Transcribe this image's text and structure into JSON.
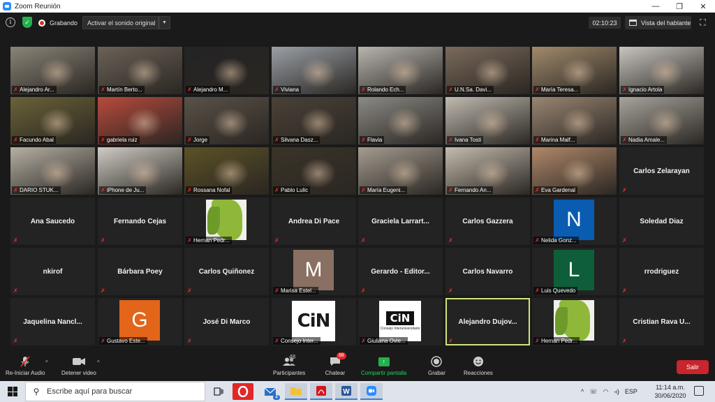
{
  "window": {
    "title": "Zoom Reunión",
    "controls": {
      "minimize": "—",
      "maximize": "❐",
      "close": "✕"
    }
  },
  "topbar": {
    "recording_label": "Grabando",
    "original_sound_label": "Activar el sonido original",
    "timer": "02:10:23",
    "view_label": "Vista del hablante"
  },
  "participants": [
    {
      "name": "Alejandro Ar...",
      "type": "video",
      "color": "#8a8478"
    },
    {
      "name": "Martín Berto...",
      "type": "video",
      "color": "#6b6258"
    },
    {
      "name": "Alejandro M...",
      "type": "video",
      "color": "#242424"
    },
    {
      "name": "Viviana",
      "type": "video",
      "color": "#9aa0a6"
    },
    {
      "name": "Rolando Ech...",
      "type": "video",
      "color": "#b8b4ae"
    },
    {
      "name": "U.N.Sa. Davi...",
      "type": "video",
      "color": "#7a6a5c"
    },
    {
      "name": "María Teresa...",
      "type": "video",
      "color": "#a08a6c"
    },
    {
      "name": "Ignacio Artola",
      "type": "video",
      "color": "#c8c4be"
    },
    {
      "name": "Facundo Abal",
      "type": "video",
      "color": "#6a6238"
    },
    {
      "name": "gabriela ruiz",
      "type": "video",
      "color": "#b84a3c"
    },
    {
      "name": "Jorge",
      "type": "video",
      "color": "#5a5248"
    },
    {
      "name": "Silvana Dasz...",
      "type": "video",
      "color": "#4a4238"
    },
    {
      "name": "Flavia",
      "type": "video",
      "color": "#8c8a84"
    },
    {
      "name": "Ivana Tosti",
      "type": "video",
      "color": "#c0bab0"
    },
    {
      "name": "Marina Malf...",
      "type": "video",
      "color": "#9a8672"
    },
    {
      "name": "Nadia Amale...",
      "type": "video",
      "color": "#a8a49c"
    },
    {
      "name": "DARIO STUK...",
      "type": "video",
      "color": "#b6b0a4"
    },
    {
      "name": "iPhone de Ju...",
      "type": "video",
      "color": "#d0ccc4"
    },
    {
      "name": "Rossana Nofal",
      "type": "video",
      "color": "#5c5226"
    },
    {
      "name": "Pablo Lulic",
      "type": "video",
      "color": "#3a3428"
    },
    {
      "name": "María Eugeni...",
      "type": "video",
      "color": "#a49c90"
    },
    {
      "name": "Fernando An...",
      "type": "video",
      "color": "#c4bcae"
    },
    {
      "name": "Eva Gardenal",
      "type": "video",
      "color": "#b0886a"
    },
    {
      "name": "Carlos Zelarayan",
      "type": "name"
    },
    {
      "name": "Ana Saucedo",
      "type": "name"
    },
    {
      "name": "Fernando Cejas",
      "type": "name"
    },
    {
      "name": "Hernan Pedr...",
      "type": "map"
    },
    {
      "name": "Andrea Di Pace",
      "type": "name"
    },
    {
      "name": "Graciela  Larrart...",
      "type": "name"
    },
    {
      "name": "Carlos Gazzera",
      "type": "name"
    },
    {
      "name": "Nelida Gonz...",
      "type": "avatar",
      "letter": "N",
      "color": "#0a5cb0"
    },
    {
      "name": "Soledad Diaz",
      "type": "name"
    },
    {
      "name": "nkirof",
      "type": "name"
    },
    {
      "name": "Bárbara Poey",
      "type": "name"
    },
    {
      "name": "Carlos Quiñonez",
      "type": "name"
    },
    {
      "name": "Marisa Estel...",
      "type": "avatar",
      "letter": "M",
      "color": "#8a7062"
    },
    {
      "name": "Gerardo  -  Editor...",
      "type": "name"
    },
    {
      "name": "Carlos Navarro",
      "type": "name"
    },
    {
      "name": "Luis Quevedo",
      "type": "avatar",
      "letter": "L",
      "color": "#0f5e3a"
    },
    {
      "name": "rrodriguez",
      "type": "name"
    },
    {
      "name": "Jaquelina  Nancl...",
      "type": "name"
    },
    {
      "name": "Gustavo Este...",
      "type": "avatar",
      "letter": "G",
      "color": "#e2651a"
    },
    {
      "name": "José Di Marco",
      "type": "name"
    },
    {
      "name": "Consejo Inter...",
      "type": "cin",
      "logo_text": "CiN"
    },
    {
      "name": "Giuliana Ovie...",
      "type": "cin-dark",
      "logo_text": "CiN",
      "logo_sub": "Consejo Interuniversitario"
    },
    {
      "name": "Alejandro  Dujov...",
      "type": "name",
      "active": true
    },
    {
      "name": "Hernan Pedr...",
      "type": "map"
    },
    {
      "name": "Cristian  Rava  U...",
      "type": "name"
    }
  ],
  "toolbar": {
    "audio_label": "Re-Iniciar Audio",
    "video_label": "Detener video",
    "participants_label": "Participantes",
    "participants_count": "48",
    "chat_label": "Chatear",
    "chat_badge": "88",
    "share_label": "Compartir pantalla",
    "record_label": "Grabar",
    "reactions_label": "Reacciones",
    "leave_label": "Salir"
  },
  "taskbar": {
    "search_placeholder": "Escribe aquí para buscar",
    "mail_badge": "4",
    "lang": "ESP",
    "time": "11:14 a.m.",
    "date": "30/06/2020"
  }
}
